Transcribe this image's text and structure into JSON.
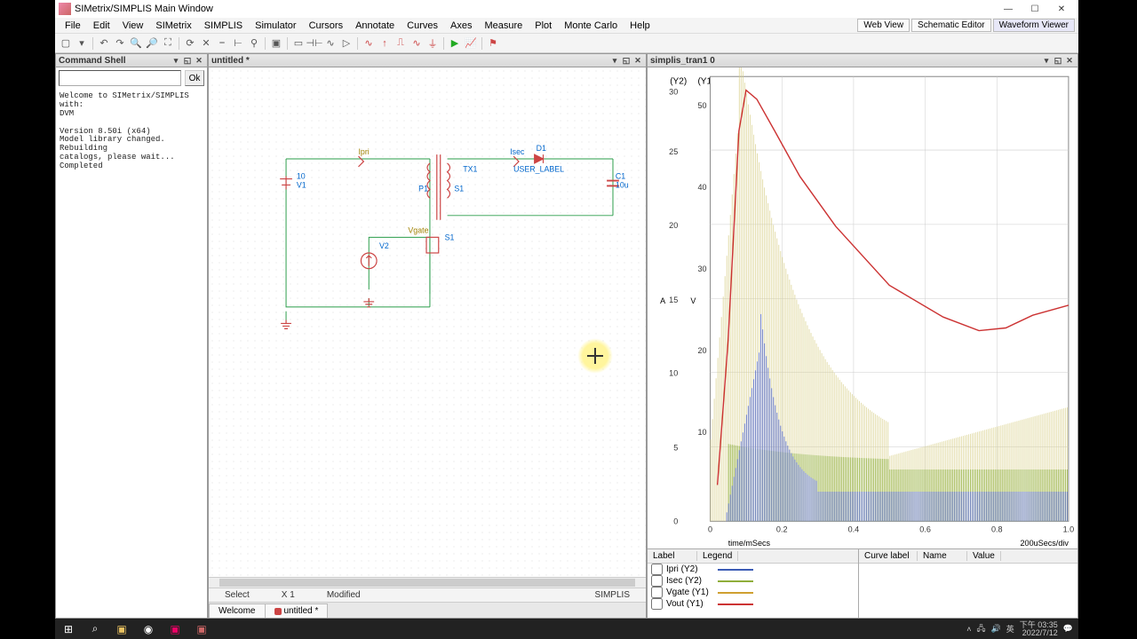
{
  "window": {
    "title": "SIMetrix/SIMPLIS Main Window"
  },
  "menus": {
    "items": [
      "File",
      "Edit",
      "View",
      "SIMetrix",
      "SIMPLIS",
      "Simulator",
      "Cursors",
      "Annotate",
      "Curves",
      "Axes",
      "Measure",
      "Plot",
      "Monte Carlo",
      "Help"
    ],
    "right_buttons": [
      "Web View",
      "Schematic Editor",
      "Waveform Viewer"
    ]
  },
  "panels": {
    "cmdshell": {
      "title": "Command Shell",
      "ok": "Ok",
      "log": "Welcome to SIMetrix/SIMPLIS  with:\nDVM\n\nVersion 8.50i (x64)\nModel library changed. Rebuilding\ncatalogs, please wait...\nCompleted"
    },
    "schematic": {
      "title": "untitled *",
      "status": {
        "mode": "Select",
        "coord": "X 1",
        "mod": "Modified",
        "sim": "SIMPLIS"
      },
      "tabs": [
        "Welcome",
        "untitled *"
      ],
      "labels": {
        "ipri": "Ipri",
        "isec": "Isec",
        "vgate": "Vgate",
        "d1": "D1",
        "user_label": "USER_LABEL",
        "c1": "C1",
        "c1v": "10u",
        "v1": "V1",
        "v1v": "10",
        "v2": "V2",
        "tx1": "TX1",
        "p1": "P1",
        "s1t": "S1",
        "s1": "S1"
      }
    },
    "waveform": {
      "title": "simplis_tran1  0",
      "y1": "(Y1)",
      "y2": "(Y2)",
      "y_unit_left": "A",
      "y_unit_right": "V",
      "xaxis_label": "time/mSecs",
      "xaxis_div": "200uSecs/div",
      "legend": {
        "hdr_left": [
          "Label",
          "Legend"
        ],
        "hdr_right": [
          "Curve label",
          "Name",
          "Value"
        ],
        "rows": [
          {
            "label": "Ipri (Y2)",
            "color": "#3b5bb5"
          },
          {
            "label": "Isec (Y2)",
            "color": "#8fae3a"
          },
          {
            "label": "Vgate (Y1)",
            "color": "#cfa030"
          },
          {
            "label": "Vout (Y1)",
            "color": "#cc3333"
          }
        ]
      }
    }
  },
  "chart_data": {
    "type": "line",
    "xlabel": "time/mSecs",
    "x_range": [
      0,
      1.0
    ],
    "x_ticks": [
      0,
      0.2,
      0.4,
      0.6,
      0.8,
      1.0
    ],
    "axes": [
      {
        "name": "Y1",
        "unit": "V",
        "ticks": [
          10,
          20,
          30,
          40,
          50
        ],
        "side": "inner-left"
      },
      {
        "name": "Y2",
        "unit": "A",
        "ticks": [
          0,
          5,
          10,
          15,
          20,
          25,
          30
        ],
        "side": "outer-left"
      }
    ],
    "series": [
      {
        "name": "Vout",
        "axis": "Y1",
        "color": "#cc3333",
        "x": [
          0.02,
          0.05,
          0.08,
          0.1,
          0.13,
          0.18,
          0.25,
          0.35,
          0.5,
          0.65,
          0.75,
          0.82,
          0.9,
          1.0
        ],
        "y": [
          5,
          22,
          48,
          53,
          52,
          48,
          42,
          36,
          29,
          25,
          23.5,
          23.8,
          25,
          26
        ]
      },
      {
        "name": "Vgate",
        "axis": "Y1",
        "color": "#cfa030",
        "note": "PWM pulse train, peak envelope ~50 at 0.07ms decaying to ~8 then rising slightly after 0.7ms"
      },
      {
        "name": "Ipri",
        "axis": "Y2",
        "color": "#3b5bb5",
        "note": "switching current pulses, peak ~12A near 0.09ms tapering to ~2A steady"
      },
      {
        "name": "Isec",
        "axis": "Y2",
        "color": "#8fae3a",
        "note": "secondary current pulses, ~3-4A steady after startup"
      }
    ]
  },
  "taskbar": {
    "time": "下午 03:35",
    "date": "2022/7/12",
    "ime": "英"
  }
}
